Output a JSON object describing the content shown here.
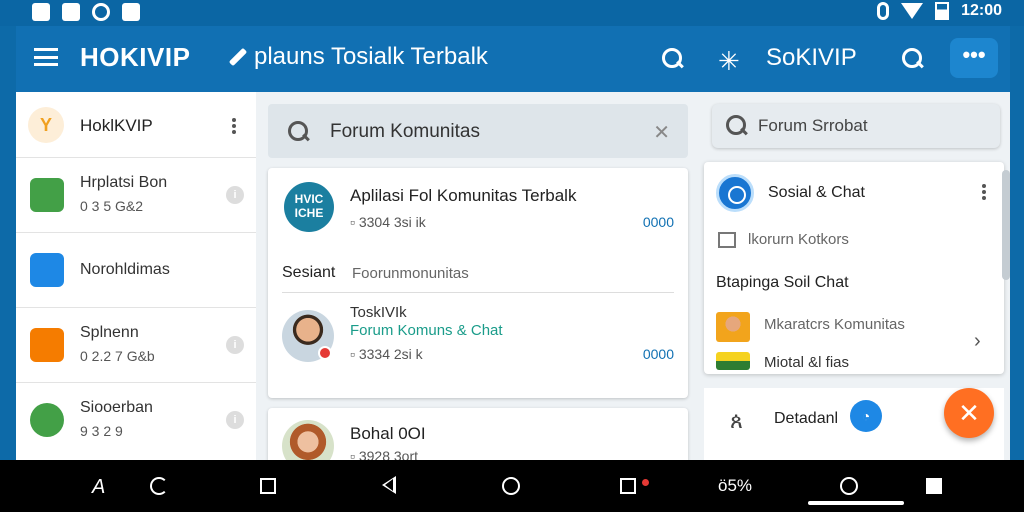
{
  "status_bar": {
    "time": "12:00"
  },
  "app_bar": {
    "brand": "HOKIVIP",
    "tagline": "plauns Tosialk Terbalk",
    "brand_right": "SoKIVIP",
    "more_label": "•••"
  },
  "sidebar": {
    "header_avatar": "Y",
    "header_title": "HoklKVIP",
    "items": [
      {
        "name": "Hrplatsi Bon",
        "meta": "0 3 5  G&2",
        "icon": "chat-icon",
        "color": "#43a047"
      },
      {
        "name": "Norohldimas",
        "meta": "",
        "icon": "document-icon",
        "color": "#1e88e5"
      },
      {
        "name": "Splnenn",
        "meta": "0 2.2 7  G&b",
        "icon": "avatar-icon",
        "color": "#f57c00"
      },
      {
        "name": "Siooerban",
        "meta": "9 3 2  9",
        "icon": "message-icon",
        "color": "#43a047"
      }
    ],
    "info_glyph": "i"
  },
  "main": {
    "search_value": "Forum Komunitas",
    "close_glyph": "✕",
    "card1": {
      "logo_text": "HVIC ICHE",
      "title": "Aplilasi Fol Komunitas Terbalk",
      "meta": "3304 3si ik",
      "count": "0000",
      "section_label": "Sesiant",
      "section_value": "Foorunmonunitas",
      "sub_title": "ToskIVIk",
      "sub_link": "Forum Komuns & Chat",
      "sub_meta": "3334 2si k",
      "sub_count": "0000"
    },
    "card2": {
      "title": "Bohal 0OI",
      "meta": "3928 3ort"
    }
  },
  "right_panel": {
    "search_value": "Forum Srrobat",
    "card": {
      "title": "Sosial & Chat",
      "subtitle": "lkorurn Kotkors",
      "section": "Btapinga Soil Chat",
      "row1": "Mkaratcrs Komunitas",
      "row2": "Miotal &l fias",
      "chevron": "›"
    },
    "detail_label": "Detadanl"
  },
  "fab": {
    "glyph": "✕",
    "color": "#ff6f22"
  },
  "nav_bar": {
    "left_glyph": "A",
    "pct_label": "ö5%"
  },
  "colors": {
    "primary": "#1170b3",
    "accent": "#ff6f22",
    "link": "#1a9c8a"
  }
}
